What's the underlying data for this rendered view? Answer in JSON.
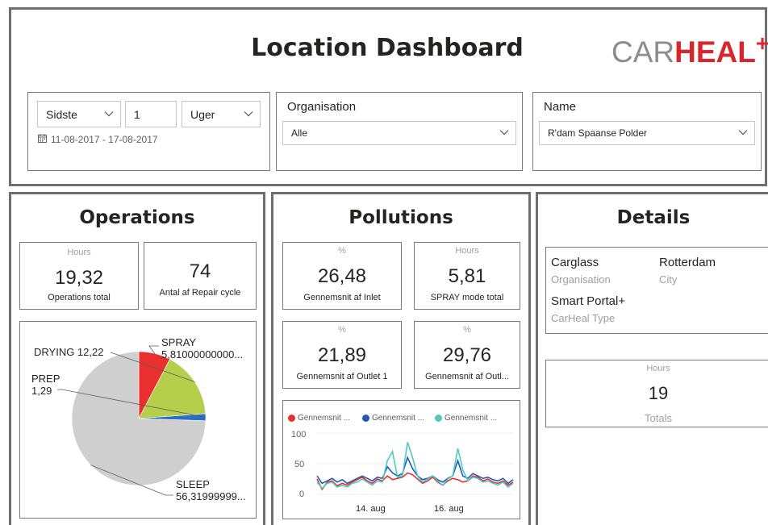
{
  "header": {
    "title": "Location Dashboard",
    "logo": {
      "part1": "CAR",
      "part2": "HEAL",
      "part3": "+"
    }
  },
  "filters": {
    "period": {
      "mode": "Sidste",
      "count": "1",
      "unit": "Uger",
      "date_range": "11-08-2017 - 17-08-2017"
    },
    "organisation": {
      "label": "Organisation",
      "value": "Alle"
    },
    "name": {
      "label": "Name",
      "value": "R'dam Spaanse Polder"
    }
  },
  "operations": {
    "title": "Operations",
    "card1": {
      "unit": "Hours",
      "value": "19,32",
      "label": "Operations total"
    },
    "card2": {
      "value": "74",
      "label": "Antal af Repair cycle"
    },
    "pie": {
      "labels": {
        "spray": [
          "SPRAY",
          "5,81000000000..."
        ],
        "drying": "DRYING 12,22",
        "prep": [
          "PREP",
          "1,29"
        ],
        "sleep": [
          "SLEEP",
          "56,31999999..."
        ]
      }
    }
  },
  "pollutions": {
    "title": "Pollutions",
    "card1": {
      "unit": "%",
      "value": "26,48",
      "label": "Gennemsnit af Inlet"
    },
    "card2": {
      "unit": "Hours",
      "value": "5,81",
      "label": "SPRAY mode total"
    },
    "card3": {
      "unit": "%",
      "value": "21,89",
      "label": "Gennemsnit af Outlet 1"
    },
    "card4": {
      "unit": "%",
      "value": "29,76",
      "label": "Gennemsnit af Outl..."
    },
    "legend": [
      "Gennemsnit ...",
      "Gennemsnit ...",
      "Gennemsnit ..."
    ],
    "y_ticks": [
      "100",
      "50",
      "0"
    ],
    "x_ticks": [
      "14. aug",
      "16. aug"
    ]
  },
  "details": {
    "title": "Details",
    "org_value": "Carglass",
    "org_label": "Organisation",
    "city_value": "Rotterdam",
    "city_label": "City",
    "type_value": "Smart Portal+",
    "type_label": "CarHeal Type",
    "totals": {
      "unit": "Hours",
      "value": "19",
      "label": "Totals"
    }
  },
  "colors": {
    "spray": "#e8312f",
    "drying": "#b5cf4a",
    "prep": "#2a6fc7",
    "sleep": "#cfcfcf",
    "series1": "#e8312f",
    "series2": "#1e5bb8",
    "series3": "#4fc9c4"
  },
  "chart_data": {
    "type": "pie",
    "categories": [
      "SPRAY",
      "DRYING",
      "PREP",
      "SLEEP"
    ],
    "values": [
      5.81,
      12.22,
      1.29,
      56.32
    ],
    "line_chart": {
      "type": "line",
      "ylim": [
        0,
        100
      ],
      "y_ticks": [
        0,
        50,
        100
      ],
      "x_ticks": [
        "14. aug",
        "16. aug"
      ],
      "series": [
        {
          "name": "Gennemsnit ...",
          "values": [
            25,
            8,
            20,
            22,
            14,
            18,
            15,
            20,
            24,
            28,
            22,
            18,
            25,
            22,
            30,
            24,
            26,
            28,
            35,
            32,
            25,
            18,
            22,
            28,
            20,
            15,
            22,
            26,
            24,
            20,
            22,
            30,
            28,
            22,
            25,
            20,
            18,
            22,
            15,
            20
          ]
        },
        {
          "name": "Gennemsnit ...",
          "values": [
            30,
            18,
            22,
            26,
            20,
            24,
            18,
            22,
            26,
            30,
            26,
            22,
            28,
            26,
            45,
            35,
            30,
            34,
            60,
            42,
            30,
            24,
            26,
            30,
            24,
            20,
            26,
            30,
            55,
            30,
            26,
            34,
            30,
            26,
            28,
            24,
            22,
            26,
            18,
            24
          ]
        },
        {
          "name": "Gennemsnit ...",
          "values": [
            20,
            10,
            18,
            20,
            12,
            15,
            12,
            18,
            20,
            25,
            20,
            15,
            22,
            20,
            55,
            70,
            28,
            30,
            85,
            60,
            30,
            20,
            25,
            30,
            22,
            15,
            25,
            30,
            75,
            40,
            22,
            28,
            26,
            20,
            22,
            18,
            15,
            20,
            12,
            18
          ]
        }
      ]
    }
  }
}
